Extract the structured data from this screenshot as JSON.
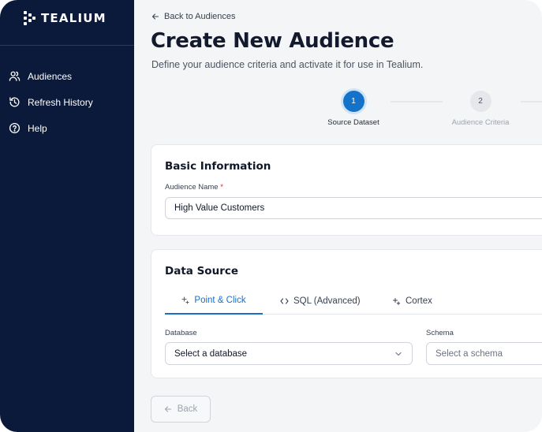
{
  "brand": {
    "name": "TEALIUM"
  },
  "sidebar": {
    "items": [
      {
        "label": "Audiences",
        "icon": "users-icon"
      },
      {
        "label": "Refresh History",
        "icon": "history-icon"
      },
      {
        "label": "Help",
        "icon": "help-circle-icon"
      }
    ]
  },
  "header": {
    "back_label": "Back to Audiences",
    "title": "Create New Audience",
    "subtitle": "Define your audience criteria and activate it for use in Tealium."
  },
  "stepper": {
    "steps": [
      {
        "number": "1",
        "label": "Source Dataset",
        "state": "active"
      },
      {
        "number": "2",
        "label": "Audience Criteria",
        "state": "pending"
      }
    ]
  },
  "basic_info": {
    "title": "Basic Information",
    "name_label": "Audience Name",
    "required_mark": "*",
    "name_value": "High Value Customers"
  },
  "data_source": {
    "title": "Data Source",
    "tabs": [
      {
        "label": "Point & Click",
        "icon": "sparkle-icon",
        "active": true
      },
      {
        "label": "SQL (Advanced)",
        "icon": "code-icon",
        "active": false
      },
      {
        "label": "Cortex",
        "icon": "sparkle-icon",
        "active": false
      }
    ],
    "database_label": "Database",
    "database_placeholder": "Select a database",
    "schema_label": "Schema",
    "schema_placeholder": "Select a schema"
  },
  "footer": {
    "back_button": "Back"
  },
  "colors": {
    "sidebar_bg": "#0b1a3a",
    "accent": "#1472c8",
    "page_bg": "#f4f5f7",
    "required": "#dc2626"
  }
}
